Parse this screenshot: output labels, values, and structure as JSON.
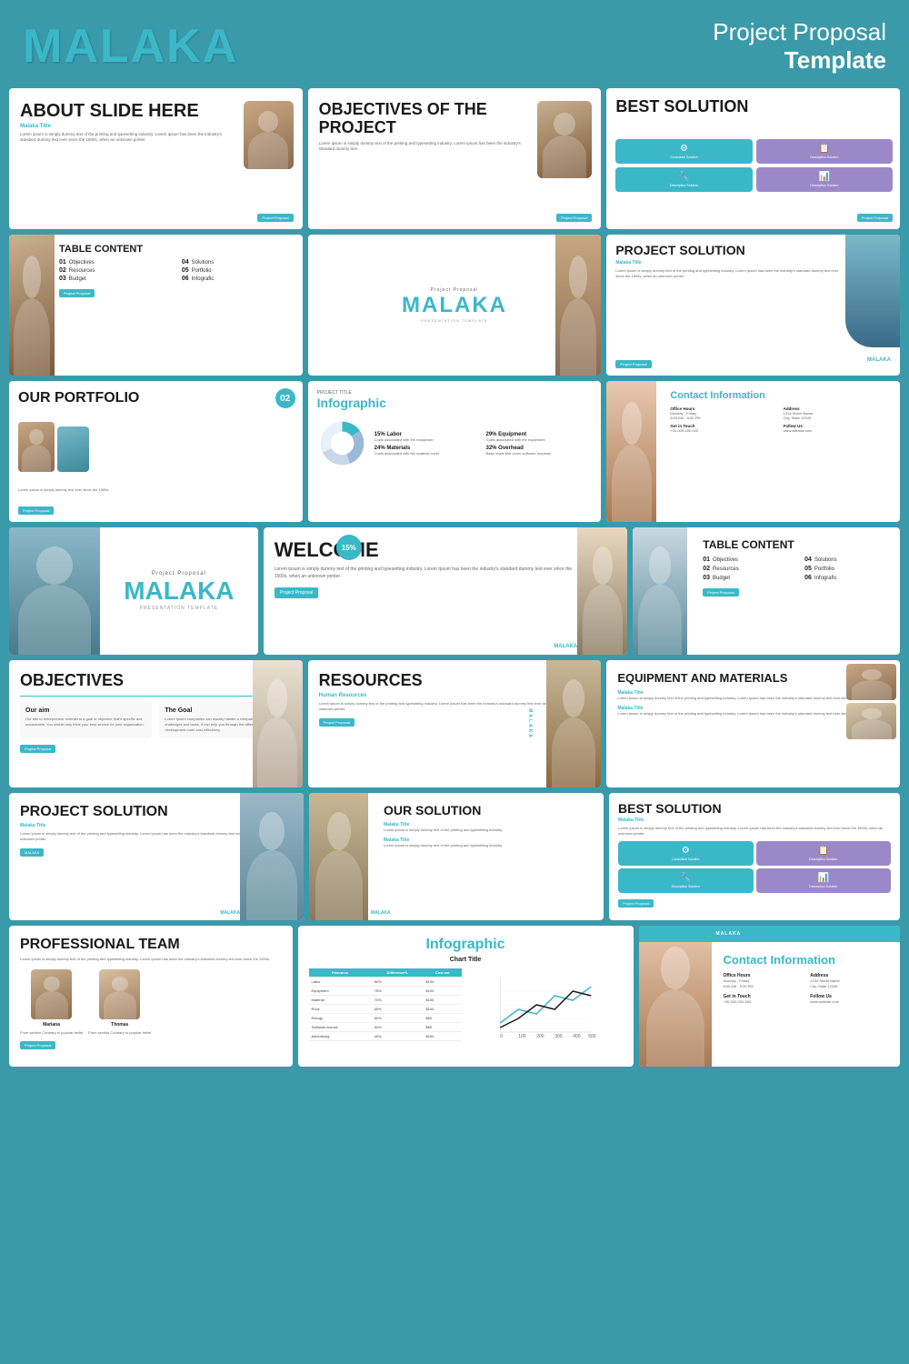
{
  "header": {
    "brand": "MALAKA",
    "title_line1": "Project Proposal",
    "title_line2": "Template"
  },
  "slides": {
    "about": {
      "heading": "ABOUT SLIDE HERE",
      "subtitle": "Malaka Title",
      "body": "Lorem ipsum is simply dummy text of the printing and typesetting industry. Lorem Ipsum has been the industry's standard dummy text ever since the 1500s, when an unknown printer.",
      "badge": "Project Proposal"
    },
    "objectives": {
      "heading": "OBJECTIVES OF THE PROJECT",
      "body": "Lorem ipsum is simply dummy text of the printing and typesetting industry. Lorem Ipsum has been the industry's standard dummy text.",
      "badge": "Project Proposal"
    },
    "best_solution": {
      "heading": "BEST SOLUTION",
      "icons": [
        {
          "label": "Consultant Solution",
          "type": "teal",
          "symbol": "⚙"
        },
        {
          "label": "Description Solution",
          "type": "purple",
          "symbol": "📋"
        },
        {
          "label": "Description Solution",
          "type": "teal",
          "symbol": "🔧"
        },
        {
          "label": "Description Solution",
          "type": "purple",
          "symbol": "📊"
        }
      ],
      "badge": "Project Proposal"
    },
    "table_content": {
      "heading": "TABLE CONTENT",
      "items": [
        {
          "num": "01",
          "label": "Objectives"
        },
        {
          "num": "04",
          "label": "Solutions"
        },
        {
          "num": "02",
          "label": "Resources"
        },
        {
          "num": "05",
          "label": "Portfolio"
        },
        {
          "num": "03",
          "label": "Budget"
        },
        {
          "num": "06",
          "label": "Infografic"
        }
      ],
      "badge": "Project Proposal"
    },
    "malaka_center": {
      "project_proposal": "Project Proposal",
      "brand": "MALAKA",
      "presentation": "PRESENTATION TEMPLATE"
    },
    "project_solution": {
      "heading": "PROJECT SOLUTION",
      "subtitle": "Malaka Title",
      "body": "Lorem ipsum is simply dummy text of the printing and typesetting industry. Lorem Ipsum has been the industry's standard dummy text ever since the 1500s, when an unknown printer.",
      "watermark": "MALAKA",
      "badge": "Project Proposal"
    },
    "portfolio": {
      "num": "02",
      "heading": "OUR PORTFOLIO",
      "body": "Lorem ipsum is simply dummy text ever since the 1500s.",
      "badge": "Project Proposal"
    },
    "infographic": {
      "heading": "Infographic",
      "project_title": "PROJECT TITLE",
      "segments": [
        {
          "pct": "15%",
          "label": "Labor",
          "color": "#3ab8c8"
        },
        {
          "pct": "29%",
          "label": "Equipment",
          "color": "#9ab8d8"
        },
        {
          "pct": "24%",
          "label": "Materials",
          "color": "#c8d8e8"
        },
        {
          "pct": "32%",
          "label": "Overhead",
          "color": "#e8f0f8"
        }
      ]
    },
    "contact": {
      "heading": "Contact Information",
      "items": [
        {
          "label": "Office Hours",
          "value": "Monday - Friday\n8:00 AM - 5:00 PM"
        },
        {
          "label": "Address",
          "value": "1234 Street Name\nCity, State 12345"
        },
        {
          "label": "Get in Touch",
          "value": "+00-000-000-000"
        },
        {
          "label": "Follow Us",
          "value": "www.website.com"
        }
      ]
    },
    "welcome": {
      "pct": "15%",
      "heading": "WELCOME",
      "body": "Lorem ipsum is simply dummy text of the printing and typesetting industry. Lorem Ipsum has been the industry's standard dummy text ever since the 1500s, when an unknown printer.",
      "badge": "Project Proposal",
      "malaka": "MALAKA"
    },
    "wide_table": {
      "heading": "TABLE CONTENT",
      "items": [
        {
          "num": "01",
          "label": "Objectives"
        },
        {
          "num": "04",
          "label": "Solutions"
        },
        {
          "num": "02",
          "label": "Resources"
        },
        {
          "num": "05",
          "label": "Portfolio"
        },
        {
          "num": "03",
          "label": "Budget"
        },
        {
          "num": "06",
          "label": "Infografic"
        }
      ],
      "badge": "Project Proposal"
    },
    "objectives_wide": {
      "heading": "OBJECTIVES",
      "col1_title": "Our aim",
      "col1_body": "Our aim to entrepreneur contract is a goal or objective that's specific and measurable. You should only think your best service for your organization.",
      "col2_title": "The Goal",
      "col2_body": "Lorem Ipsum companies can usually handle a company's specific challenges and tasks. It can help you through the different phases of your development more cost-effectively.",
      "badge": "Project Proposal"
    },
    "resources_wide": {
      "heading": "RESOURCES",
      "subtitle": "Human Resources",
      "body": "Lorem ipsum is simply dummy text of the printing and typesetting industry. Lorem Ipsum has been the industry's standard dummy text ever since the 1500s, when an unknown printer.",
      "badge": "Project Proposal",
      "malaka": "MALAKA"
    },
    "equipment": {
      "heading": "EQUIPMENT AND MATERIALS",
      "item1_subtitle": "Malaka Title",
      "item1_body": "Lorem ipsum is simply dummy text of the printing and typesetting industry. Lorem Ipsum has been the industry's standard dummy text ever since the 1500s.",
      "item2_subtitle": "Malaka Title",
      "item2_body": "Lorem ipsum is simply dummy text of the printing and typesetting industry. Lorem Ipsum has been the industry's standard dummy text ever since the 1500s."
    },
    "proj_sol_wide": {
      "heading": "PROJECT SOLUTION",
      "subtitle": "Malaka Title",
      "body": "Lorem ipsum is simply dummy text of the printing and typesetting industry. Lorem Ipsum has been the industry's standard dummy text ever since the 1500s, when an unknown printer.",
      "badge": "MALAKA",
      "malaka": "MALAKA"
    },
    "our_sol_wide": {
      "heading": "OUR SOLUTION",
      "item1_subtitle": "Malaka Title",
      "item1_body": "Lorem ipsum is simply dummy text of the printing and typesetting Industry",
      "item2_subtitle": "Malaka Title",
      "item2_body": "Lorem ipsum is simply dummy text of the printing and typesetting Industry",
      "malaka": "MALAKA"
    },
    "best_sol_wide": {
      "heading": "BEST SOLUTION",
      "subtitle": "Malaka Title",
      "body": "Lorem ipsum is simply dummy text of the printing and typesetting industry. Lorem Ipsum has been the industry's standard dummy text ever since the 1500s, when an unknown printer.",
      "badge": "Project Proposal"
    },
    "prof_team": {
      "heading": "PROFESSIONAL TEAM",
      "body": "Lorem ipsum is simply dummy text of the printing and typesetting industry. Lorem Ipsum has been the industry's standard dummy text ever since the 1500s.",
      "members": [
        {
          "name": "Mariana",
          "role": "From section Contrary to popular belief, it's not simply random text"
        },
        {
          "name": "Thomas",
          "role": "From section Contrary to popular belief, it's not simply random text"
        }
      ],
      "badge": "Project Proposal"
    },
    "infographic_wide": {
      "heading": "Infographic",
      "chart_title": "Chart Title",
      "table_headers": [
        "Resource",
        "Difference%",
        "Cost est"
      ],
      "table_rows": [
        [
          "Labor",
          "80%",
          "$100"
        ],
        [
          "Equipment",
          "75%",
          "$100"
        ],
        [
          "Material",
          "70%",
          "$100"
        ],
        [
          "Rock",
          "65%",
          "$100"
        ],
        [
          "Energy",
          "60%",
          "$60"
        ],
        [
          "Software license",
          "50%",
          "$80"
        ],
        [
          "Advertising",
          "40%",
          "$200"
        ]
      ]
    },
    "contact_wide": {
      "heading": "Contact Information",
      "malaka": "MALAKA",
      "items": [
        {
          "label": "Office Hours",
          "value": "Monday - Friday\n8:00 AM - 5:00 PM"
        },
        {
          "label": "Address",
          "value": "1234 Street Name\nCity, State 12345"
        },
        {
          "label": "Get in Touch",
          "value": "+00-000-000-000"
        },
        {
          "label": "Follow Us",
          "value": "www.website.com"
        }
      ]
    }
  }
}
